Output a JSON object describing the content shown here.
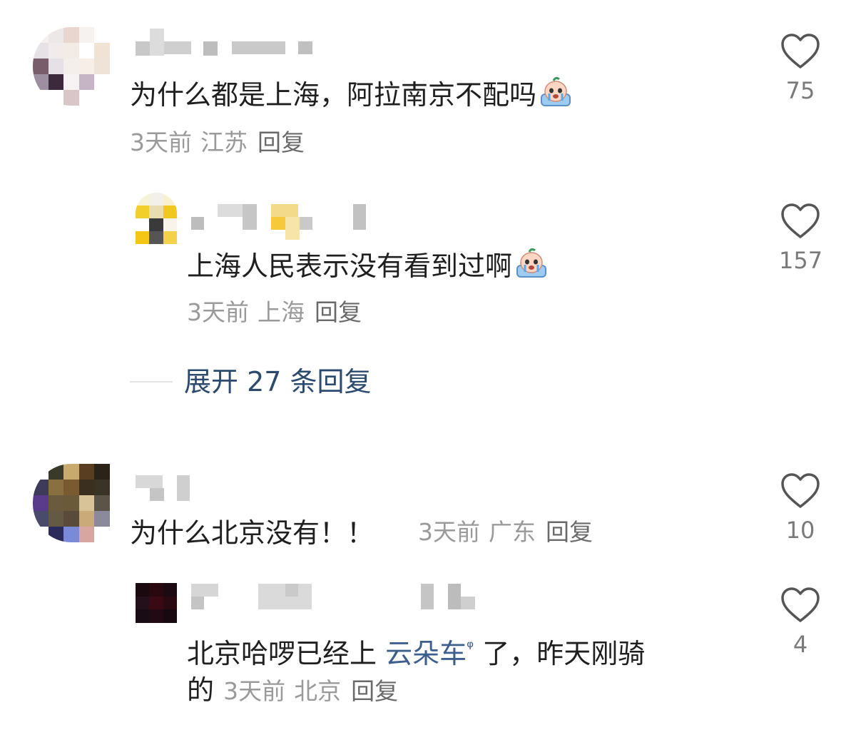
{
  "comments": [
    {
      "text": "为什么都是上海，阿拉南京不配吗",
      "time": "3天前",
      "location": "江苏",
      "reply_label": "回复",
      "likes": "75",
      "has_emoji": true
    },
    {
      "text": "上海人民表示没有看到过啊",
      "time": "3天前",
      "location": "上海",
      "reply_label": "回复",
      "likes": "157",
      "has_emoji": true,
      "is_reply": true
    },
    {
      "text": "为什么北京没有！！",
      "time": "3天前",
      "location": "广东",
      "reply_label": "回复",
      "likes": "10"
    },
    {
      "text_prefix": "北京哈啰已经上",
      "link_text": "云朵车",
      "text_suffix": "了，昨天刚骑",
      "text_line2": "的",
      "time": "3天前",
      "location": "北京",
      "reply_label": "回复",
      "likes": "4",
      "is_reply": true
    }
  ],
  "expand_replies": {
    "label": "展开 27 条回复"
  },
  "icons": {
    "like": "heart-outline-icon",
    "emoji": "crying-face-emoji-icon",
    "search_hint": "search-icon"
  },
  "colors": {
    "link": "#3d5f8c",
    "expand": "#2c4a6e",
    "meta": "#9a9a9a",
    "reply": "#6a6a6a"
  }
}
